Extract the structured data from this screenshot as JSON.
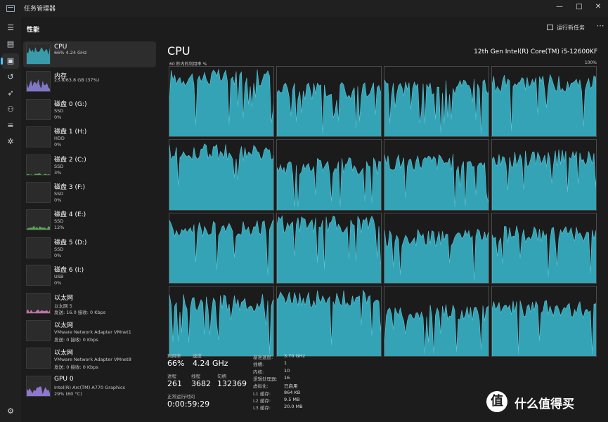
{
  "window": {
    "title": "任务管理器",
    "minimize": "—",
    "maximize": "□",
    "close": "✕"
  },
  "header": {
    "title": "性能",
    "run_task": "运行新任务",
    "more": "⋯"
  },
  "rail": {
    "items": [
      {
        "icon": "hamburger-menu-icon",
        "glyph": "☰"
      },
      {
        "icon": "processes-icon",
        "glyph": "▤"
      },
      {
        "icon": "performance-icon",
        "glyph": "▣",
        "active": true
      },
      {
        "icon": "app-history-icon",
        "glyph": "↺"
      },
      {
        "icon": "startup-apps-icon",
        "glyph": "➶"
      },
      {
        "icon": "users-icon",
        "glyph": "⚇"
      },
      {
        "icon": "details-icon",
        "glyph": "≡"
      },
      {
        "icon": "services-icon",
        "glyph": "✲"
      },
      {
        "icon": "settings-icon",
        "glyph": "⚙"
      }
    ]
  },
  "sidebar": {
    "devices": [
      {
        "name": "CPU",
        "line1": "66% 4.24 GHz",
        "line2": "",
        "color": "#3ba7b8",
        "fill": 0.66,
        "active": true
      },
      {
        "name": "内存",
        "line1": "23.8/63.8 GB (37%)",
        "line2": "",
        "color": "#8a7ed8",
        "fill": 0.37
      },
      {
        "name": "磁盘 0 (G:)",
        "line1": "SSD",
        "line2": "0%",
        "color": "#5fb35a",
        "fill": 0
      },
      {
        "name": "磁盘 1 (H:)",
        "line1": "HDD",
        "line2": "0%",
        "color": "#5fb35a",
        "fill": 0
      },
      {
        "name": "磁盘 2 (C:)",
        "line1": "SSD",
        "line2": "3%",
        "color": "#5fb35a",
        "fill": 0.03
      },
      {
        "name": "磁盘 3 (F:)",
        "line1": "SSD",
        "line2": "0%",
        "color": "#5fb35a",
        "fill": 0
      },
      {
        "name": "磁盘 4 (E:)",
        "line1": "SSD",
        "line2": "12%",
        "color": "#5fb35a",
        "fill": 0.12
      },
      {
        "name": "磁盘 5 (D:)",
        "line1": "SSD",
        "line2": "0%",
        "color": "#5fb35a",
        "fill": 0
      },
      {
        "name": "磁盘 6 (I:)",
        "line1": "USB",
        "line2": "0%",
        "color": "#5fb35a",
        "fill": 0
      },
      {
        "name": "以太网",
        "line1": "以太网 5",
        "line2": "发送: 16.0  接收: 0 Kbps",
        "color": "#d47ab8",
        "fill": 0.1
      },
      {
        "name": "以太网",
        "line1": "VMware Network Adapter VMnet1",
        "line2": "发送: 0  接收: 0 Kbps",
        "color": "#d47ab8",
        "fill": 0
      },
      {
        "name": "以太网",
        "line1": "VMware Network Adapter VMnet8",
        "line2": "发送: 0  接收: 0 Kbps",
        "color": "#d47ab8",
        "fill": 0
      },
      {
        "name": "GPU 0",
        "line1": "Intel(R) Arc(TM) A770 Graphics",
        "line2": "29% (60 °C)",
        "color": "#9a7ee0",
        "fill": 0.29
      }
    ]
  },
  "main": {
    "title": "CPU",
    "model": "12th Gen Intel(R) Core(TM) i5-12600KF",
    "axis_caption": "60 秒内的利用率 %",
    "axis_max": "100%",
    "graph_color": "#34a3b5",
    "core_count": 16,
    "core_level_avg": 0.75
  },
  "stats": {
    "utilization": {
      "label": "利用率",
      "value": "66%"
    },
    "speed": {
      "label": "速度",
      "value": "4.24 GHz"
    },
    "processes": {
      "label": "进程",
      "value": "261"
    },
    "threads": {
      "label": "线程",
      "value": "3682"
    },
    "handles": {
      "label": "句柄",
      "value": "132369"
    },
    "uptime": {
      "label": "正常运行时间",
      "value": "0:00:59:29"
    }
  },
  "specs": [
    {
      "key": "基准速度:",
      "value": "3.70 GHz"
    },
    {
      "key": "插槽:",
      "value": "1"
    },
    {
      "key": "内核:",
      "value": "10"
    },
    {
      "key": "逻辑处理器:",
      "value": "16"
    },
    {
      "key": "虚拟化:",
      "value": "已启用"
    },
    {
      "key": "L1 缓存:",
      "value": "864 KB"
    },
    {
      "key": "L2 缓存:",
      "value": "9.5 MB"
    },
    {
      "key": "L3 缓存:",
      "value": "20.0 MB"
    }
  ],
  "watermark": {
    "logo": "值",
    "text": "什么值得买"
  }
}
